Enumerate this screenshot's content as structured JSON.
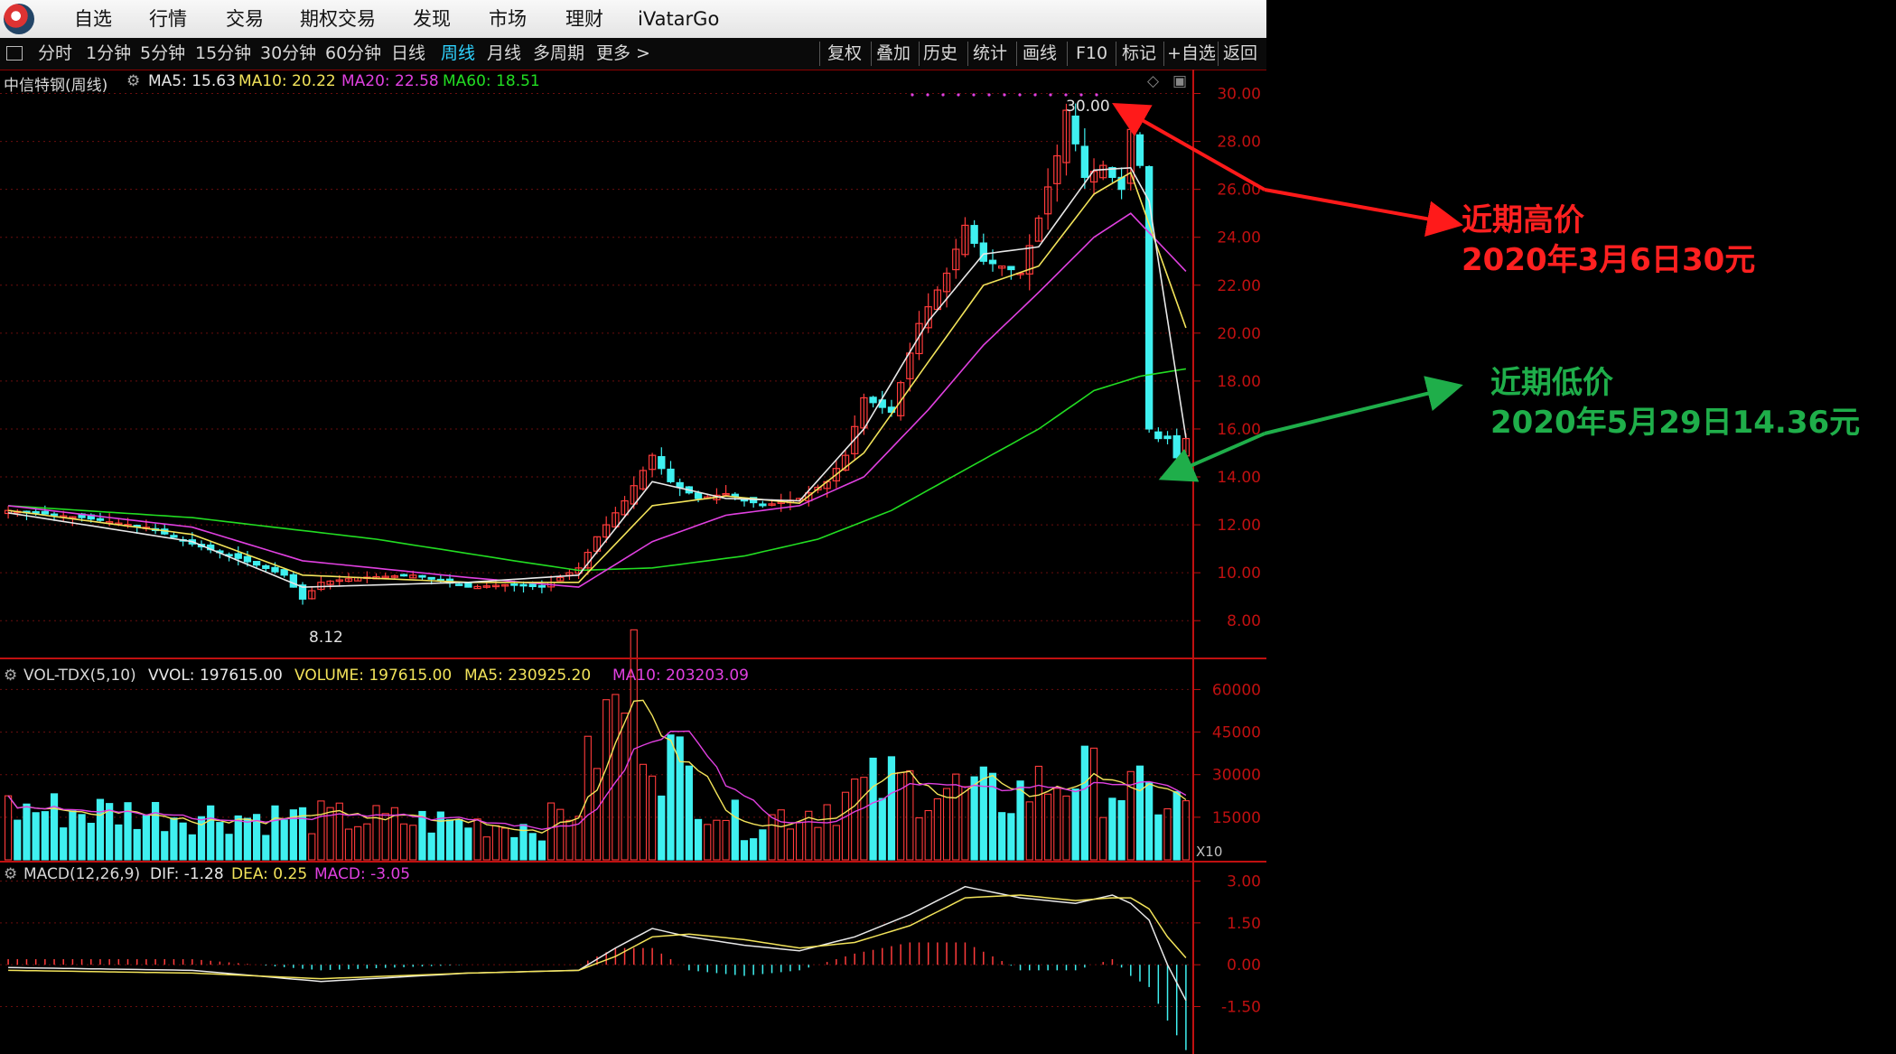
{
  "menu": {
    "items": [
      "自选",
      "行情",
      "交易",
      "期权交易",
      "发现",
      "市场",
      "理财",
      "iVatarGo"
    ]
  },
  "toolbar": {
    "periods": [
      "分时",
      "1分钟",
      "5分钟",
      "15分钟",
      "30分钟",
      "60分钟",
      "日线",
      "周线",
      "月线",
      "多周期",
      "更多 >"
    ],
    "active_period": "周线",
    "actions": [
      "复权",
      "叠加",
      "历史",
      "统计",
      "画线",
      "F10",
      "标记",
      "+自选",
      "返回"
    ]
  },
  "price_panel": {
    "title": "中信特钢(周线)",
    "ma_items": [
      {
        "label": "MA5: 15.63",
        "color": "#e8e8e8"
      },
      {
        "label": "MA10: 20.22",
        "color": "#f2e35a"
      },
      {
        "label": "MA20: 22.58",
        "color": "#e040e0"
      },
      {
        "label": "MA60: 18.51",
        "color": "#22dd22"
      }
    ],
    "high_marker": "30.00",
    "low_marker": "8.12"
  },
  "volume_panel": {
    "title": "VOL-TDX(5,10)",
    "items": [
      {
        "label": "VVOL: 197615.00",
        "color": "#e8e8e8"
      },
      {
        "label": "VOLUME: 197615.00",
        "color": "#f2e35a"
      },
      {
        "label": "MA5: 230925.20",
        "color": "#f2e35a"
      },
      {
        "label": "MA10: 203203.09",
        "color": "#e040e0"
      }
    ],
    "unit": "X10"
  },
  "macd_panel": {
    "title": "MACD(12,26,9)",
    "items": [
      {
        "label": "DIF: -1.28",
        "color": "#e8e8e8"
      },
      {
        "label": "DEA: 0.25",
        "color": "#f2e35a"
      },
      {
        "label": "MACD: -3.05",
        "color": "#e040e0"
      }
    ]
  },
  "annotations": {
    "high_line1": "近期高价",
    "high_line2": "2020年3月6日30元",
    "low_line1": "近期低价",
    "low_line2": "2020年5月29日14.36元"
  },
  "colors": {
    "up": "#ff3b3b",
    "down": "#3ff0f0",
    "ma5": "#e8e8e8",
    "ma10": "#f2e35a",
    "ma20": "#e040e0",
    "ma60": "#22dd22",
    "axis": "#c01010",
    "annot_high": "#ff2020",
    "annot_low": "#1fae4a"
  },
  "chart_data": [
    {
      "type": "candlestick",
      "name": "price",
      "y_ticks": [
        8,
        10,
        12,
        14,
        16,
        18,
        20,
        22,
        24,
        26,
        28,
        30
      ],
      "ylim": [
        6.5,
        31.0
      ],
      "close_anchors": [
        [
          0,
          12.6
        ],
        [
          8,
          12.3
        ],
        [
          15,
          11.9
        ],
        [
          20,
          11.2
        ],
        [
          25,
          10.6
        ],
        [
          30,
          9.9
        ],
        [
          32,
          8.9
        ],
        [
          34,
          9.6
        ],
        [
          38,
          9.8
        ],
        [
          44,
          9.9
        ],
        [
          50,
          9.4
        ],
        [
          54,
          9.5
        ],
        [
          58,
          9.4
        ],
        [
          62,
          10.2
        ],
        [
          64,
          11.5
        ],
        [
          67,
          13.0
        ],
        [
          70,
          14.9
        ],
        [
          72,
          13.8
        ],
        [
          75,
          13.1
        ],
        [
          78,
          13.3
        ],
        [
          82,
          12.8
        ],
        [
          86,
          13.1
        ],
        [
          89,
          13.8
        ],
        [
          91,
          14.9
        ],
        [
          93,
          17.3
        ],
        [
          96,
          16.7
        ],
        [
          99,
          20.4
        ],
        [
          102,
          22.5
        ],
        [
          104,
          24.5
        ],
        [
          106,
          23.0
        ],
        [
          108,
          22.8
        ],
        [
          110,
          22.5
        ],
        [
          112,
          24.8
        ],
        [
          114,
          27.4
        ],
        [
          115,
          29.3
        ],
        [
          117,
          26.5
        ],
        [
          119,
          27.0
        ],
        [
          121,
          26.0
        ],
        [
          122,
          28.5
        ],
        [
          123,
          27.0
        ],
        [
          124,
          16.0
        ],
        [
          125,
          15.6
        ],
        [
          126,
          15.6
        ],
        [
          127,
          14.8
        ],
        [
          128,
          15.6
        ]
      ],
      "ma_anchors": {
        "ma5": [
          [
            0,
            12.5
          ],
          [
            20,
            11.3
          ],
          [
            32,
            9.4
          ],
          [
            50,
            9.6
          ],
          [
            62,
            9.9
          ],
          [
            70,
            13.8
          ],
          [
            78,
            13.1
          ],
          [
            86,
            13.0
          ],
          [
            93,
            16.0
          ],
          [
            100,
            20.5
          ],
          [
            106,
            23.3
          ],
          [
            112,
            23.6
          ],
          [
            118,
            26.8
          ],
          [
            122,
            26.9
          ],
          [
            124,
            25.5
          ],
          [
            128,
            15.63
          ]
        ],
        "ma10": [
          [
            0,
            12.6
          ],
          [
            20,
            11.6
          ],
          [
            32,
            9.9
          ],
          [
            50,
            9.6
          ],
          [
            62,
            9.6
          ],
          [
            70,
            12.8
          ],
          [
            78,
            13.2
          ],
          [
            86,
            12.9
          ],
          [
            93,
            15.0
          ],
          [
            100,
            18.8
          ],
          [
            106,
            22.0
          ],
          [
            112,
            22.8
          ],
          [
            118,
            25.8
          ],
          [
            122,
            26.7
          ],
          [
            128,
            20.22
          ]
        ],
        "ma20": [
          [
            0,
            12.8
          ],
          [
            20,
            11.9
          ],
          [
            32,
            10.5
          ],
          [
            50,
            9.8
          ],
          [
            62,
            9.4
          ],
          [
            70,
            11.3
          ],
          [
            78,
            12.4
          ],
          [
            86,
            12.8
          ],
          [
            93,
            14.0
          ],
          [
            100,
            16.8
          ],
          [
            106,
            19.5
          ],
          [
            112,
            21.7
          ],
          [
            118,
            24.0
          ],
          [
            122,
            25.0
          ],
          [
            128,
            22.58
          ]
        ],
        "ma60": [
          [
            0,
            12.8
          ],
          [
            20,
            12.3
          ],
          [
            40,
            11.4
          ],
          [
            55,
            10.5
          ],
          [
            62,
            10.1
          ],
          [
            70,
            10.2
          ],
          [
            80,
            10.7
          ],
          [
            88,
            11.4
          ],
          [
            96,
            12.6
          ],
          [
            104,
            14.3
          ],
          [
            112,
            16.0
          ],
          [
            118,
            17.6
          ],
          [
            123,
            18.2
          ],
          [
            128,
            18.51
          ]
        ]
      }
    },
    {
      "type": "bar",
      "name": "volume",
      "unit": "X10",
      "y_ticks": [
        15000,
        30000,
        45000,
        60000
      ],
      "ylim": [
        0,
        70000
      ],
      "vol_anchors": [
        [
          0,
          18000
        ],
        [
          10,
          17000
        ],
        [
          20,
          16000
        ],
        [
          30,
          15000
        ],
        [
          40,
          14000
        ],
        [
          50,
          13000
        ],
        [
          58,
          12000
        ],
        [
          62,
          20000
        ],
        [
          64,
          42000
        ],
        [
          66,
          52000
        ],
        [
          68,
          62000
        ],
        [
          70,
          44000
        ],
        [
          72,
          36000
        ],
        [
          76,
          22000
        ],
        [
          80,
          12000
        ],
        [
          84,
          16000
        ],
        [
          88,
          18000
        ],
        [
          92,
          24000
        ],
        [
          96,
          27000
        ],
        [
          100,
          26000
        ],
        [
          104,
          24000
        ],
        [
          108,
          22000
        ],
        [
          112,
          26000
        ],
        [
          116,
          30000
        ],
        [
          120,
          26000
        ],
        [
          124,
          22000
        ],
        [
          128,
          19762
        ]
      ]
    },
    {
      "type": "bar",
      "name": "macd",
      "y_ticks": [
        -1.5,
        0.0,
        1.5,
        3.0
      ],
      "ylim": [
        -3.2,
        3.6
      ],
      "dif_anchors": [
        [
          0,
          -0.1
        ],
        [
          20,
          -0.2
        ],
        [
          34,
          -0.6
        ],
        [
          50,
          -0.3
        ],
        [
          62,
          -0.2
        ],
        [
          66,
          0.6
        ],
        [
          70,
          1.3
        ],
        [
          74,
          1.0
        ],
        [
          80,
          0.7
        ],
        [
          86,
          0.5
        ],
        [
          92,
          1.0
        ],
        [
          98,
          1.8
        ],
        [
          104,
          2.8
        ],
        [
          110,
          2.4
        ],
        [
          116,
          2.2
        ],
        [
          120,
          2.5
        ],
        [
          122,
          2.2
        ],
        [
          124,
          1.6
        ],
        [
          126,
          0.0
        ],
        [
          128,
          -1.28
        ]
      ],
      "dea_anchors": [
        [
          0,
          -0.2
        ],
        [
          20,
          -0.3
        ],
        [
          34,
          -0.5
        ],
        [
          50,
          -0.3
        ],
        [
          62,
          -0.2
        ],
        [
          66,
          0.3
        ],
        [
          70,
          1.0
        ],
        [
          74,
          1.1
        ],
        [
          80,
          0.9
        ],
        [
          86,
          0.6
        ],
        [
          92,
          0.8
        ],
        [
          98,
          1.4
        ],
        [
          104,
          2.4
        ],
        [
          110,
          2.5
        ],
        [
          116,
          2.3
        ],
        [
          120,
          2.4
        ],
        [
          122,
          2.4
        ],
        [
          124,
          2.0
        ],
        [
          126,
          1.0
        ],
        [
          128,
          0.25
        ]
      ]
    }
  ]
}
